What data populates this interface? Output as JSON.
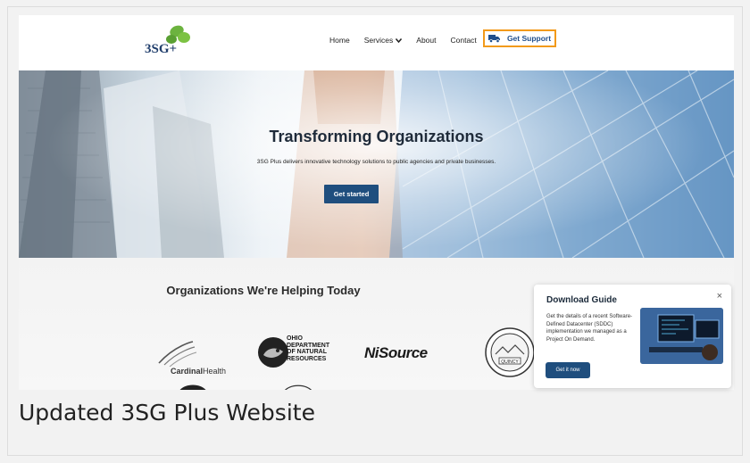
{
  "site": {
    "logo_text": "3SG+",
    "nav": {
      "home": "Home",
      "services": "Services",
      "about": "About",
      "contact": "Contact",
      "support": "Get Support"
    },
    "hero": {
      "title": "Transforming Organizations",
      "subtitle": "3SG Plus delivers innovative technology solutions to public agencies and private businesses.",
      "cta": "Get started"
    },
    "orgs": {
      "title": "Organizations We're Helping Today",
      "cardinal_bold": "Cardinal",
      "cardinal_rest": "Health",
      "odnr_lines": [
        "OHIO",
        "DEPARTMENT",
        "OF NATURAL",
        "RESOURCES"
      ],
      "nisource": "NiSource",
      "seal_text": "QUINCY"
    },
    "popup": {
      "title": "Download Guide",
      "body": "Get the details of a recent Software-Defined Datacenter (SDDC) implementation we managed as a Project On Demand.",
      "button": "Get it now",
      "close": "×"
    }
  },
  "caption": "Updated 3SG Plus Website",
  "colors": {
    "accent_orange": "#f29a1a",
    "brand_blue": "#1f4e7e",
    "logo_green": "#6cb33f"
  }
}
